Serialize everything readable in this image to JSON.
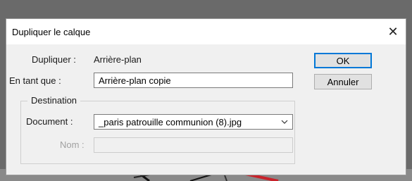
{
  "dialog": {
    "title": "Dupliquer le calque",
    "close_glyph": "✕"
  },
  "form": {
    "duplicate_label": "Dupliquer :",
    "duplicate_value": "Arrière-plan",
    "as_label": "En tant que :",
    "as_value": "Arrière-plan copie",
    "destination_legend": "Destination",
    "document_label": "Document :",
    "document_value": "_paris patrouille communion (8).jpg",
    "name_label": "Nom :",
    "name_value": ""
  },
  "buttons": {
    "ok": "OK",
    "cancel": "Annuler"
  },
  "icons": {
    "close": "close-icon",
    "dropdown": "chevron-down-icon"
  },
  "colors": {
    "accent": "#0078d7",
    "dialog_bg": "#f0f0f0"
  }
}
